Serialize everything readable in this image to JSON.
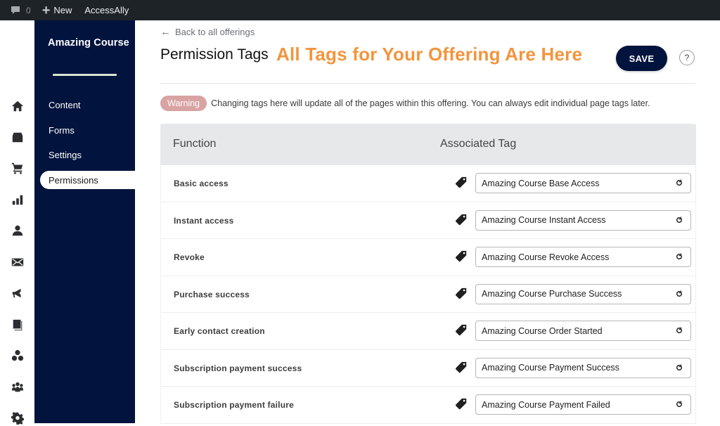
{
  "adminbar": {
    "comments_count": "0",
    "new_label": "New",
    "brand": "AccessAlly"
  },
  "rail": {
    "icons": [
      "home-icon",
      "store-icon",
      "cart-icon",
      "bar-chart-icon",
      "user-icon",
      "mail-icon",
      "megaphone-icon",
      "book-icon",
      "circles-icon",
      "team-icon",
      "gear-icon"
    ]
  },
  "sidebar": {
    "title": "Amazing Course",
    "items": [
      {
        "label": "Content",
        "active": false
      },
      {
        "label": "Forms",
        "active": false
      },
      {
        "label": "Settings",
        "active": false
      },
      {
        "label": "Permissions",
        "active": true
      }
    ]
  },
  "header": {
    "back_label": "Back to all offerings",
    "title": "Permission Tags",
    "annotation": "All Tags for Your Offering Are Here",
    "save_label": "SAVE",
    "help_label": "?"
  },
  "warning": {
    "badge": "Warning",
    "text": "Changing tags here will update all of the pages within this offering. You can always edit individual page tags later."
  },
  "table": {
    "columns": [
      "Function",
      "Associated Tag"
    ],
    "rows": [
      {
        "function": "Basic access",
        "tag": "Amazing Course Base Access"
      },
      {
        "function": "Instant access",
        "tag": "Amazing Course Instant Access"
      },
      {
        "function": "Revoke",
        "tag": "Amazing Course Revoke Access"
      },
      {
        "function": "Purchase success",
        "tag": "Amazing Course Purchase Success"
      },
      {
        "function": "Early contact creation",
        "tag": "Amazing Course Order Started"
      },
      {
        "function": "Subscription payment success",
        "tag": "Amazing Course Payment Success"
      },
      {
        "function": "Subscription payment failure",
        "tag": "Amazing Course Payment Failed"
      }
    ]
  },
  "colors": {
    "sidebar_bg": "#02133d",
    "accent_orange": "#f2953e",
    "warning_badge": "#d9a3a3",
    "adminbar_bg": "#1d2327"
  }
}
